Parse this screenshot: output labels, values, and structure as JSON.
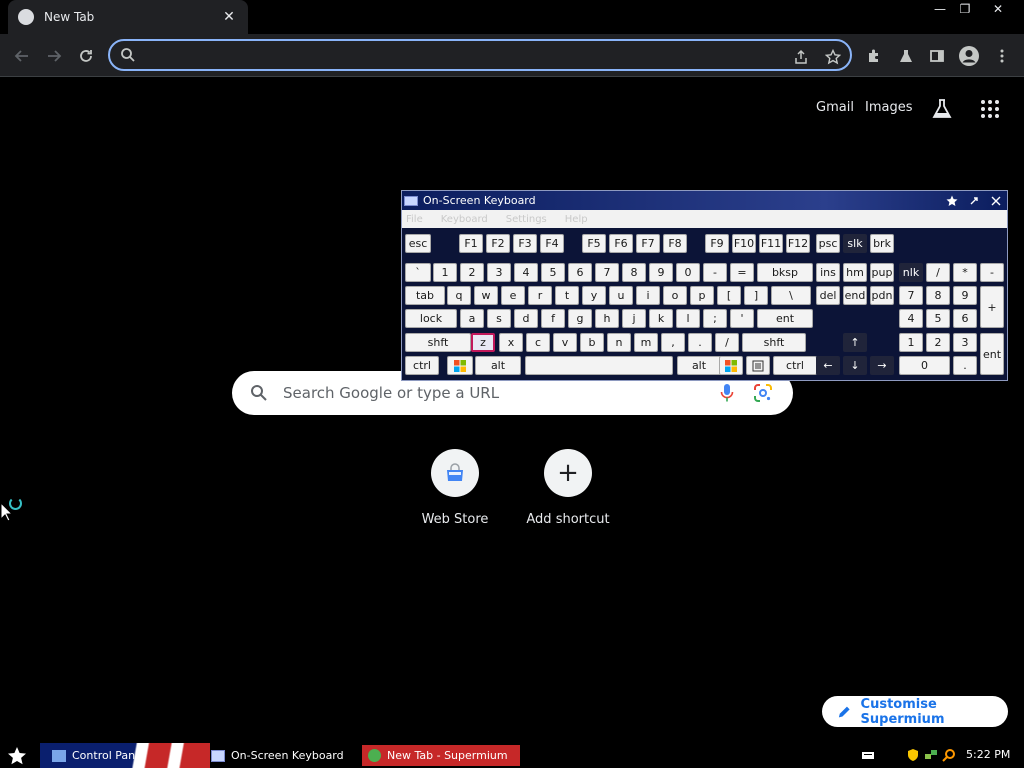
{
  "browser": {
    "tab_title": "New Tab",
    "tab_close": "✕",
    "omnibox_value": "",
    "window_controls": {
      "minimize": "—",
      "restore": "❐",
      "close": "✕"
    }
  },
  "ntp": {
    "links": {
      "gmail": "Gmail",
      "images": "Images"
    },
    "search_placeholder": "Search Google or type a URL",
    "shortcuts": [
      {
        "label": "Web Store"
      },
      {
        "label": "Add shortcut",
        "glyph": "+"
      }
    ],
    "customise_label": "Customise Supermium"
  },
  "osk": {
    "title": "On-Screen Keyboard",
    "menus": [
      "File",
      "Keyboard",
      "Settings",
      "Help"
    ],
    "keys": {
      "row1": [
        "esc",
        "F1",
        "F2",
        "F3",
        "F4",
        "F5",
        "F6",
        "F7",
        "F8",
        "F9",
        "F10",
        "F11",
        "F12",
        "psc",
        "slk",
        "brk"
      ],
      "row2": [
        "`",
        "1",
        "2",
        "3",
        "4",
        "5",
        "6",
        "7",
        "8",
        "9",
        "0",
        "-",
        "=",
        "bksp",
        "ins",
        "hm",
        "pup",
        "nlk",
        "/",
        "*",
        "-"
      ],
      "row3": [
        "tab",
        "q",
        "w",
        "e",
        "r",
        "t",
        "y",
        "u",
        "i",
        "o",
        "p",
        "[",
        "]",
        "\\",
        "del",
        "end",
        "pdn",
        "7",
        "8",
        "9",
        "+"
      ],
      "row4": [
        "lock",
        "a",
        "s",
        "d",
        "f",
        "g",
        "h",
        "j",
        "k",
        "l",
        ";",
        "'",
        "ent",
        "4",
        "5",
        "6"
      ],
      "row5": [
        "shft",
        "z",
        "x",
        "c",
        "v",
        "b",
        "n",
        "m",
        ",",
        ".",
        "/",
        "shft",
        "1",
        "2",
        "3",
        "ent"
      ],
      "row6": [
        "ctrl",
        "alt",
        "alt",
        "ctrl",
        "0",
        "."
      ]
    },
    "arrows": {
      "up": "↑",
      "left": "←",
      "down": "↓",
      "right": "→"
    }
  },
  "taskbar": {
    "items": [
      "Control Panel",
      "On-Screen Keyboard",
      "New Tab - Supermium"
    ],
    "clock": "5:22 PM"
  },
  "colors": {
    "accent": "#8ab4f8",
    "link_blue": "#1a73e8",
    "osk_bg": "#0c1437",
    "pressed_border": "#c2185b"
  }
}
